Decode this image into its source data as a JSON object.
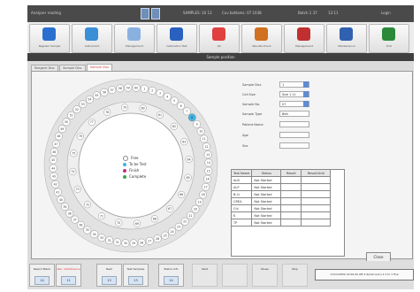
{
  "titlebar": {
    "left": "Analyzer reading",
    "status1": "SAMPLES: 10 13",
    "status2": "Cuv bottoms: 07 1038",
    "status3": "Batch 1 37",
    "status4": "13:11",
    "status5": "Login"
  },
  "toolbar": [
    {
      "label": "Register Sample",
      "icon": "register-icon",
      "color": "#2a6fd0"
    },
    {
      "label": "Instrument",
      "icon": "instrument-icon",
      "color": "#3a8fd6"
    },
    {
      "label": "Management",
      "icon": "management-icon",
      "color": "#8ab0e0"
    },
    {
      "label": "Calibration Test",
      "icon": "calibration-icon",
      "color": "#2a60c0"
    },
    {
      "label": "QC",
      "icon": "qc-icon",
      "color": "#e04040"
    },
    {
      "label": "Results Check",
      "icon": "results-icon",
      "color": "#d07020"
    },
    {
      "label": "Management",
      "icon": "management2-icon",
      "color": "#c03030"
    },
    {
      "label": "Maintenance",
      "icon": "maintenance-icon",
      "color": "#3060b0"
    },
    {
      "label": "Exit",
      "icon": "exit-icon",
      "color": "#2a8a3a"
    }
  ],
  "section_title": "Sample position",
  "tabs": [
    "Reagent Disc",
    "Sample Disc",
    "Sample Disc"
  ],
  "legend": [
    {
      "label": "Free",
      "color": "#ffffff"
    },
    {
      "label": "To be Test",
      "color": "#3fb4e6"
    },
    {
      "label": "Finish",
      "color": "#c03080"
    },
    {
      "label": "Complete",
      "color": "#3aa64a"
    }
  ],
  "form": [
    {
      "label": "Sample Disc",
      "value": "1",
      "dropdown": true
    },
    {
      "label": "Cell Size",
      "value": "Size 1 1t",
      "dropdown": true
    },
    {
      "label": "Sample No.",
      "value": "07",
      "dropdown": true
    },
    {
      "label": "Sample Type",
      "value": "Belt",
      "dropdown": false
    },
    {
      "label": "Patient Name",
      "value": "",
      "dropdown": false
    },
    {
      "label": "Age",
      "value": "",
      "dropdown": false
    },
    {
      "label": "Sex",
      "value": "",
      "dropdown": false
    }
  ],
  "table": {
    "headers": [
      "Test Name",
      "Status",
      "Result",
      "Result/Unit"
    ],
    "rows": [
      [
        "ALB",
        "Not Started",
        "",
        ""
      ],
      [
        "ALP",
        "Not Started",
        "",
        ""
      ],
      [
        "B-Cr",
        "Not Started",
        "",
        ""
      ],
      [
        "CREA",
        "Not Started",
        "",
        ""
      ],
      [
        "Chl",
        "Not Started",
        "",
        ""
      ],
      [
        "K",
        "Not Started",
        "",
        ""
      ],
      [
        "TP",
        "Not Started",
        "",
        ""
      ]
    ]
  },
  "close_label": "Close",
  "bottom": [
    {
      "title": "Report Blank",
      "value": "14",
      "style": "normal"
    },
    {
      "title": "Abn. Interference",
      "value": "11",
      "style": "red"
    },
    {
      "title": "Rest",
      "value": "13",
      "style": "normal"
    },
    {
      "title": "Test Samples",
      "value": "13",
      "style": "normal"
    },
    {
      "title": "Status Info",
      "value": "14",
      "style": "normal"
    },
    {
      "title": "Start",
      "value": "",
      "style": "dis"
    },
    {
      "title": "",
      "value": "",
      "style": "dis"
    },
    {
      "title": "Pause",
      "value": "",
      "style": "dis"
    },
    {
      "title": "Stop",
      "value": "",
      "style": "dis"
    }
  ],
  "status_box": "17/11/2009 14:09:44 AM 2.9/(Vacuum) 2.1 to 1 fine",
  "disc": {
    "outer_numbers": [
      "1",
      "2",
      "3",
      "4",
      "5",
      "6",
      "7",
      "8",
      "9",
      "10",
      "11",
      "12",
      "13",
      "14",
      "15",
      "16",
      "17",
      "18",
      "19",
      "20",
      "21",
      "22",
      "23",
      "24",
      "25",
      "26",
      "27",
      "28",
      "29",
      "30",
      "31",
      "32",
      "33",
      "34",
      "35",
      "36",
      "37",
      "38",
      "39",
      "40",
      "41",
      "42",
      "43",
      "44",
      "45",
      "46",
      "47",
      "48",
      "49",
      "50",
      "51",
      "52",
      "53",
      "54",
      "55",
      "56",
      "57",
      "58",
      "59",
      "60"
    ],
    "inner_numbers": [
      "61",
      "62",
      "63",
      "64",
      "65",
      "66",
      "67",
      "68",
      "69",
      "70",
      "71",
      "72",
      "73",
      "74",
      "75",
      "76",
      "77",
      "78",
      "79",
      "80"
    ],
    "highlighted": "8"
  }
}
